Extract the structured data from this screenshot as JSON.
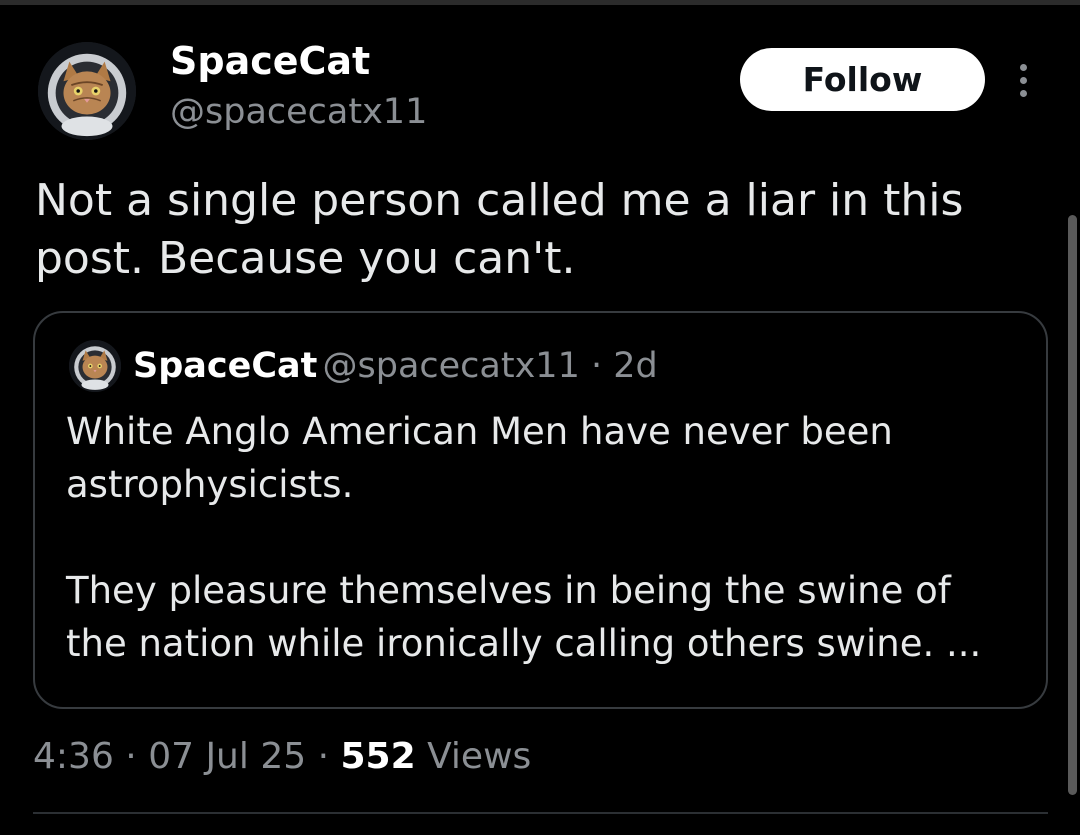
{
  "post": {
    "author": {
      "display_name": "SpaceCat",
      "handle": "@spacecatx11"
    },
    "follow_label": "Follow",
    "text_lines": [
      "Not a single person called me a liar in this",
      "post. Because you can't."
    ],
    "quoted": {
      "display_name": "SpaceCat",
      "meta": "@spacecatx11 · 2d",
      "paragraphs": [
        [
          "White Anglo American Men have never been",
          "astrophysicists."
        ],
        [
          "They pleasure themselves in being the swine of",
          "the nation while ironically calling others swine. ..."
        ]
      ]
    },
    "time": "4:36",
    "date": "07 Jul 25",
    "views_count": "552",
    "views_label": "Views"
  },
  "icons": {
    "avatar": "astronaut-cat-avatar",
    "more": "more-vertical-icon"
  },
  "colors": {
    "background": "#000000",
    "text": "#e7e9ea",
    "secondary": "#8b8f94",
    "border": "#373b3f",
    "button_bg": "#ffffff"
  }
}
